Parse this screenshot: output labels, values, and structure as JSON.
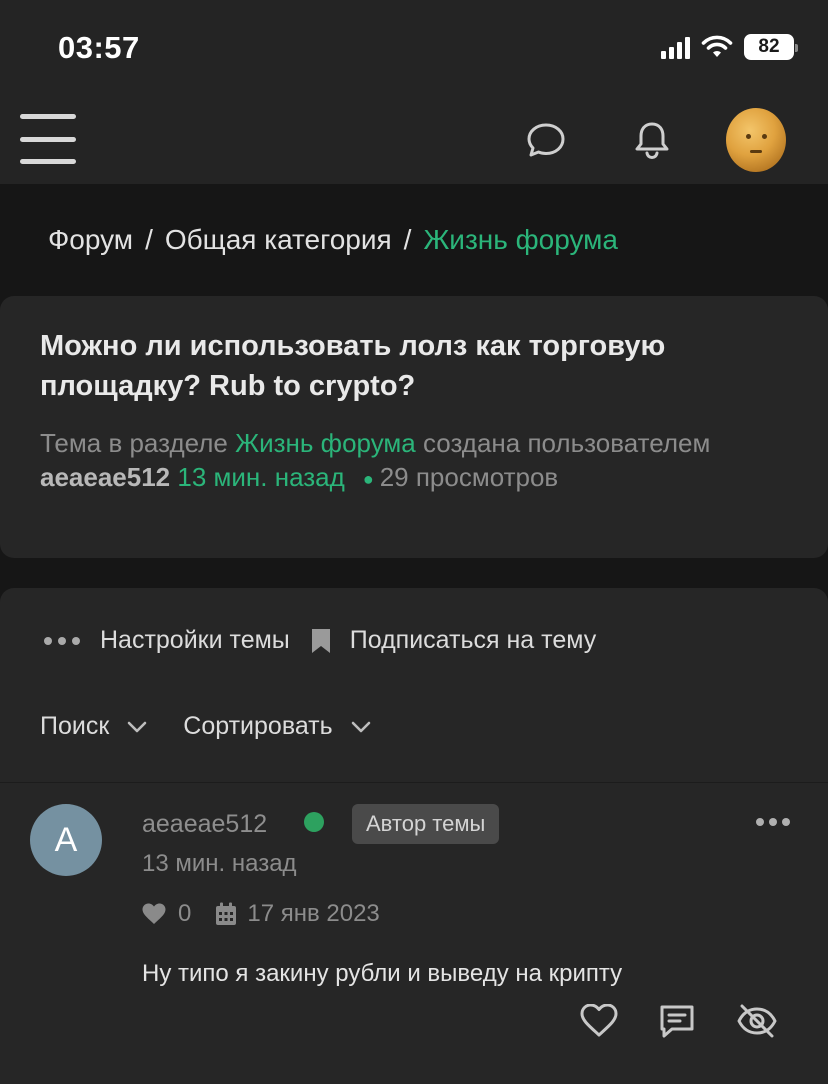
{
  "status_bar": {
    "time": "03:57",
    "battery": "82"
  },
  "header": {
    "menu_icon": "menu-icon",
    "chat_icon": "chat-bubble-icon",
    "bell_icon": "bell-icon",
    "avatar": "user-avatar"
  },
  "breadcrumb": {
    "items": [
      "Форум",
      "Общая категория",
      "Жизнь форума"
    ],
    "separator": "/"
  },
  "topic": {
    "title": "Можно ли использовать лолз как торговую площадку? Rub to crypto?",
    "meta_prefix": "Тема в разделе",
    "section": "Жизнь форума",
    "created_by": "создана пользователем",
    "author": "aeaeae512",
    "time_ago": "13 мин. назад",
    "views_count": "29",
    "views_label": "просмотров"
  },
  "thread_actions": {
    "settings": "Настройки темы",
    "subscribe": "Подписаться на тему"
  },
  "filters": {
    "search": "Поиск",
    "sort": "Сортировать"
  },
  "post": {
    "avatar_letter": "A",
    "author": "aeaeae512",
    "badge": "Автор темы",
    "time_ago": "13 мин. назад",
    "likes": "0",
    "date": "17 янв 2023",
    "body": "Ну типо я закину рубли и выведу на крипту"
  },
  "colors": {
    "accent": "#2bb57a",
    "background": "#161616",
    "card": "#262626",
    "online": "#2da15f"
  }
}
